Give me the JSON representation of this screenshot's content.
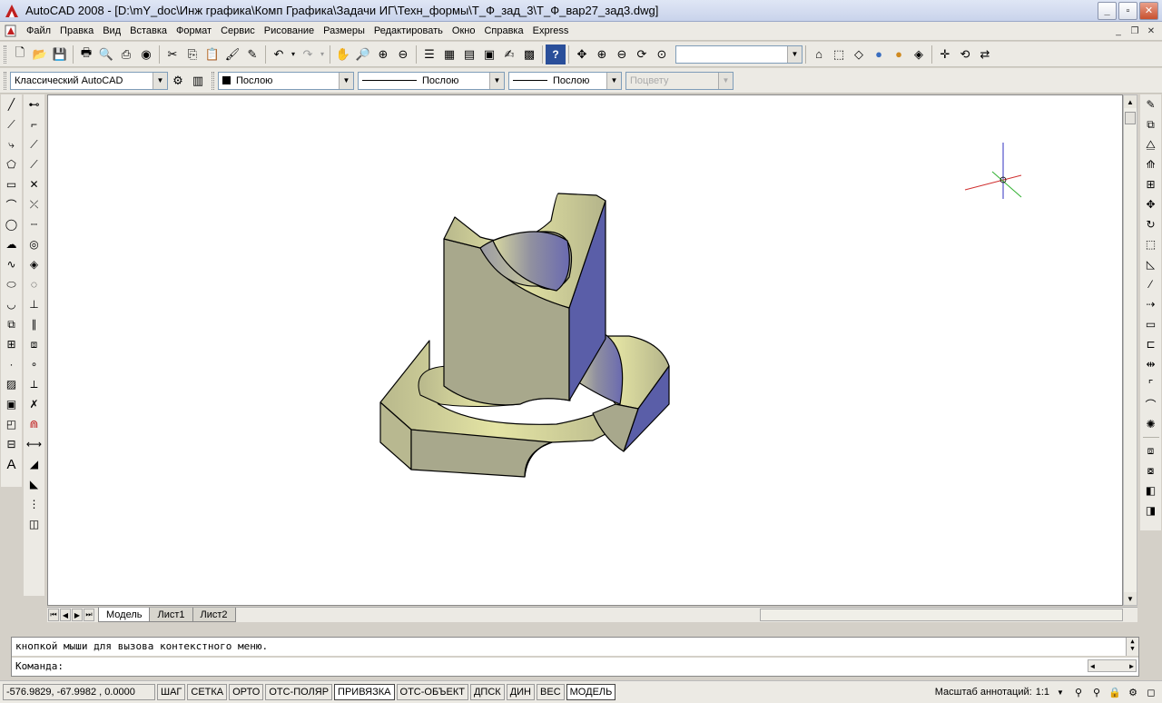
{
  "window": {
    "title": "AutoCAD 2008 - [D:\\mY_doc\\Инж графика\\Комп Графика\\Задачи ИГ\\Техн_формы\\Т_Ф_зад_3\\Т_Ф_вар27_зад3.dwg]",
    "minimize": "_",
    "maximize": "▫",
    "close": "✕"
  },
  "menu": {
    "items": [
      "Файл",
      "Правка",
      "Вид",
      "Вставка",
      "Формат",
      "Сервис",
      "Рисование",
      "Размеры",
      "Редактировать",
      "Окно",
      "Справка",
      "Express"
    ]
  },
  "toolbar2": {
    "workspace": "Классический AutoCAD",
    "color": "Послою",
    "linetype": "Послою",
    "lineweight": "Послою",
    "plotstyle": "Поцвету"
  },
  "tabs": [
    "Модель",
    "Лист1",
    "Лист2"
  ],
  "command": {
    "history": "кнопкой мыши для вызова контекстного меню.",
    "prompt": "Команда:"
  },
  "status": {
    "coords": "-576.9829, -67.9982 , 0.0000",
    "buttons": [
      "ШАГ",
      "СЕТКА",
      "ОРТО",
      "ОТС-ПОЛЯР",
      "ПРИВЯЗКА",
      "ОТС-ОБЪЕКТ",
      "ДПСК",
      "ДИН",
      "ВЕС",
      "МОДЕЛЬ"
    ],
    "pressed": [
      "ПРИВЯЗКА",
      "МОДЕЛЬ"
    ],
    "annotation_label": "Масштаб аннотаций:",
    "annotation_value": "1:1"
  },
  "colors": {
    "solid_face": "#a8a88a",
    "solid_light": "#e0e0a0",
    "solid_side": "#5a5ea8",
    "ucs_x": "#d03030",
    "ucs_y": "#30b030",
    "ucs_z": "#3030c0"
  }
}
